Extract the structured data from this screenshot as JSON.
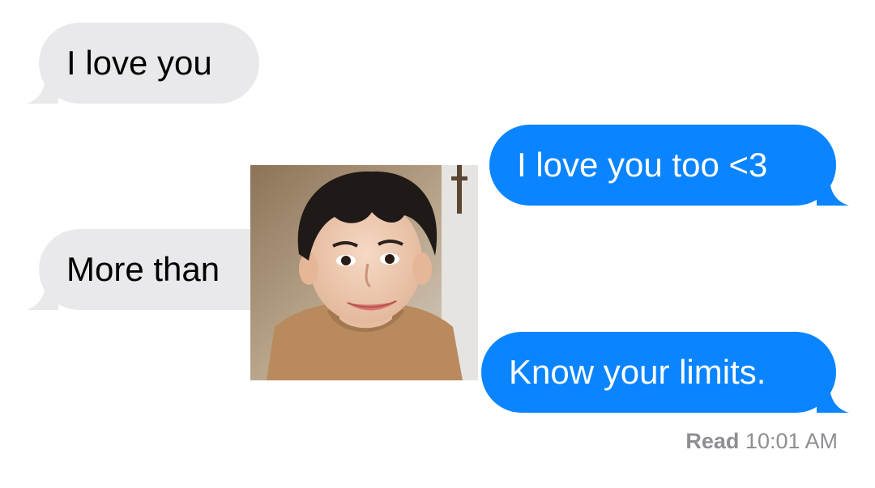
{
  "colors": {
    "incoming_bubble": "#e9e9eb",
    "outgoing_bubble": "#0a84ff",
    "receipt_text": "#8e8e93"
  },
  "messages": [
    {
      "direction": "incoming",
      "text": "I love you"
    },
    {
      "direction": "outgoing",
      "text": "I love you too <3"
    },
    {
      "direction": "incoming",
      "text": "More than"
    },
    {
      "direction": "outgoing",
      "text": "Know your limits."
    }
  ],
  "receipt": {
    "status": "Read",
    "time": "10:01 AM"
  }
}
